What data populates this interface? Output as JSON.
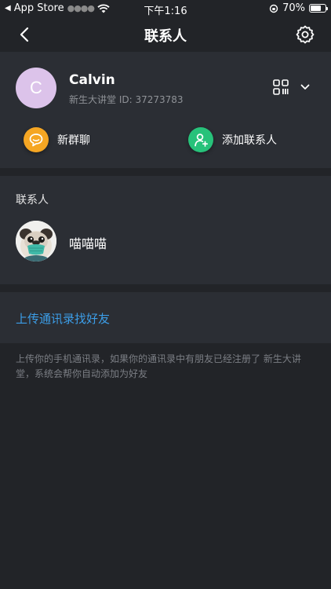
{
  "status_bar": {
    "carrier": "App Store",
    "time": "下午1:16",
    "battery": "70%",
    "battery_level": 0.7
  },
  "nav": {
    "title": "联系人"
  },
  "profile": {
    "avatar_letter": "C",
    "name": "Calvin",
    "uid_text": "新生大讲堂 ID: 37273783"
  },
  "actions": {
    "new_group": "新群聊",
    "add_contact": "添加联系人"
  },
  "contacts": {
    "header": "联系人",
    "items": [
      {
        "name": "喵喵喵"
      }
    ]
  },
  "upload": {
    "link": "上传通讯录找好友",
    "hint": "上传你的手机通讯录，如果你的通讯录中有朋友已经注册了 新生大讲堂，系统会帮你自动添加为好友"
  },
  "colors": {
    "background": "#222428",
    "card": "#2b2e34",
    "accent_blue": "#3c9ee8",
    "orange": "#f5a623",
    "green": "#27c27a"
  }
}
